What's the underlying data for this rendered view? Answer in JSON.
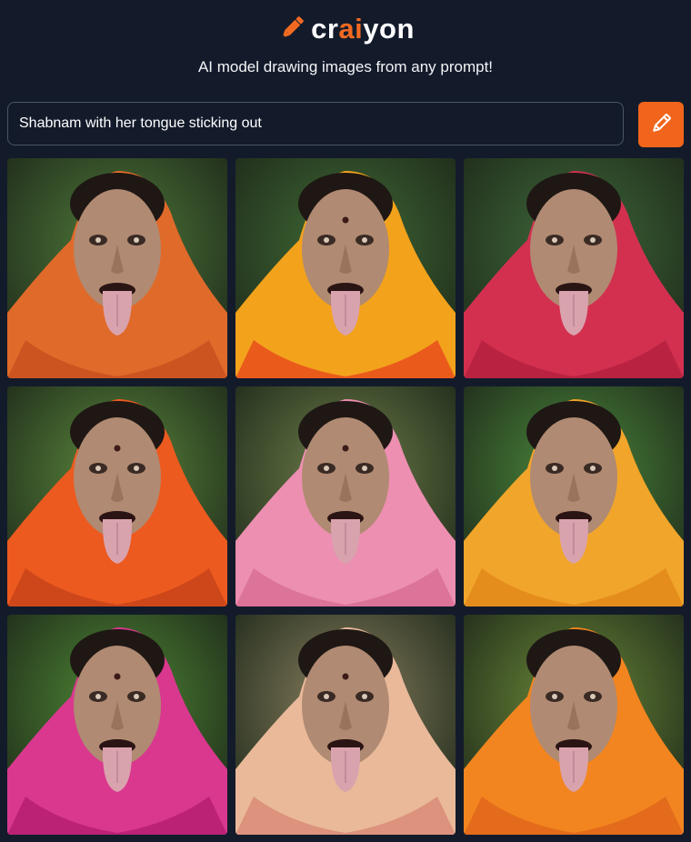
{
  "brand": {
    "logo_prefix": "cr",
    "logo_accent": "ai",
    "logo_suffix": "yon",
    "accent_color": "#f26a21",
    "background_color": "#131b2b"
  },
  "tagline": "AI model drawing images from any prompt!",
  "prompt": {
    "value": "Shabnam with her tongue sticking out",
    "submit_icon": "pencil-icon"
  },
  "results": [
    {
      "bg": "#4f7a3a",
      "scarf": "#e06a2a",
      "scarf2": "#c8501e",
      "bindi": false
    },
    {
      "bg": "#3f6b35",
      "scarf": "#f3a21c",
      "scarf2": "#e84f1b",
      "bindi": true
    },
    {
      "bg": "#3e6a3a",
      "scarf": "#d3304f",
      "scarf2": "#b52040",
      "bindi": false
    },
    {
      "bg": "#5b8a3d",
      "scarf": "#ec5a1f",
      "scarf2": "#c9441a",
      "bindi": true
    },
    {
      "bg": "#6e7f4a",
      "scarf": "#ec8fb0",
      "scarf2": "#d96f95",
      "bindi": true
    },
    {
      "bg": "#4b8a3c",
      "scarf": "#f1a52a",
      "scarf2": "#e2881b",
      "bindi": false
    },
    {
      "bg": "#4f8a35",
      "scarf": "#d9388e",
      "scarf2": "#b51f72",
      "bindi": true
    },
    {
      "bg": "#8a8060",
      "scarf": "#e9b99a",
      "scarf2": "#d98b78",
      "bindi": true
    },
    {
      "bg": "#6c8a38",
      "scarf": "#f2851f",
      "scarf2": "#e0661b",
      "bindi": false
    }
  ]
}
